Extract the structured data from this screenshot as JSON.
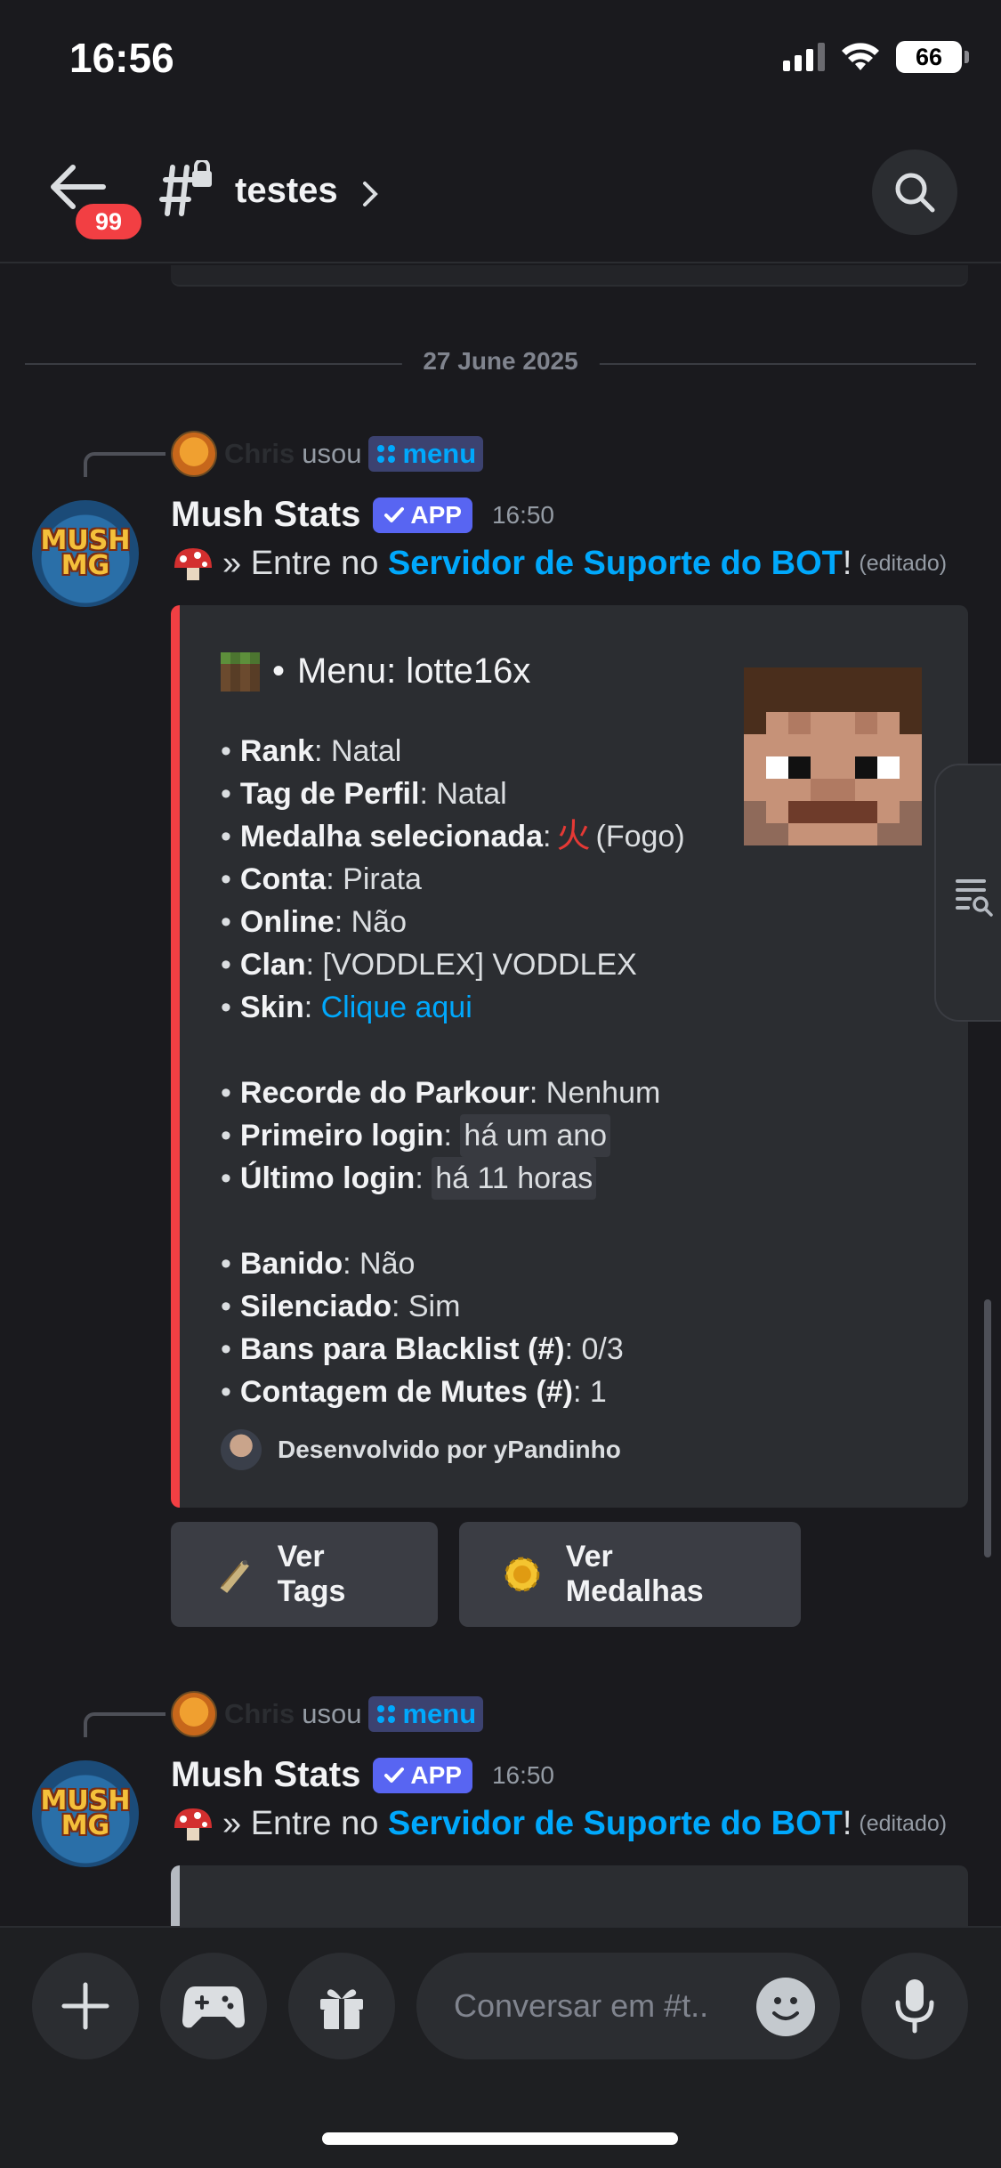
{
  "status_bar": {
    "time": "16:56",
    "battery": "66"
  },
  "header": {
    "badge_count": "99",
    "channel_name": "testes"
  },
  "chat": {
    "date_divider": "27 June 2025",
    "messages": [
      {
        "reply_user": "Chris",
        "reply_action": "usou",
        "command": "menu",
        "author": "Mush Stats",
        "app_tag": "APP",
        "timestamp": "16:50",
        "content_prefix": "» Entre no",
        "content_link": "Servidor de Suporte do BOT",
        "content_suffix": "!",
        "edited": "(editado)",
        "embed": {
          "title": "Menu: lotte16x",
          "fields": [
            {
              "name": "Rank",
              "value": "Natal"
            },
            {
              "name": "Tag de Perfil",
              "value": "Natal"
            },
            {
              "name": "Medalha selecionada",
              "glyph": "火",
              "value": "(Fogo)"
            },
            {
              "name": "Conta",
              "value": "Pirata"
            },
            {
              "name": "Online",
              "value": "Não"
            },
            {
              "name": "Clan",
              "value": "[VODDLEX] VODDLEX"
            },
            {
              "name": "Skin",
              "value": "Clique aqui"
            },
            {
              "name": "Recorde do Parkour",
              "value": "Nenhum"
            },
            {
              "name": "Primeiro login",
              "value": "há um ano"
            },
            {
              "name": "Último login",
              "value": "há 11 horas"
            },
            {
              "name": "Banido",
              "value": "Não"
            },
            {
              "name": "Silenciado",
              "value": "Sim"
            },
            {
              "name": "Bans para Blacklist (#)",
              "value": "0/3"
            },
            {
              "name": "Contagem de Mutes (#)",
              "value": "1"
            }
          ],
          "footer": "Desenvolvido por yPandinho"
        },
        "buttons": [
          {
            "label": "Ver Tags",
            "icon": "name-tag-icon"
          },
          {
            "label": "Ver Medalhas",
            "icon": "medal-icon"
          }
        ]
      },
      {
        "reply_user": "Chris",
        "reply_action": "usou",
        "command": "menu",
        "author": "Mush Stats",
        "app_tag": "APP",
        "timestamp": "16:50",
        "content_prefix": "» Entre no",
        "content_link": "Servidor de Suporte do BOT",
        "content_suffix": "!",
        "edited": "(editado)"
      }
    ]
  },
  "input": {
    "placeholder": "Conversar em #t.."
  },
  "colors": {
    "accent": "#5865f2",
    "link": "#00a8fc",
    "embed_border": "#f23f43",
    "badge": "#f23f43"
  }
}
